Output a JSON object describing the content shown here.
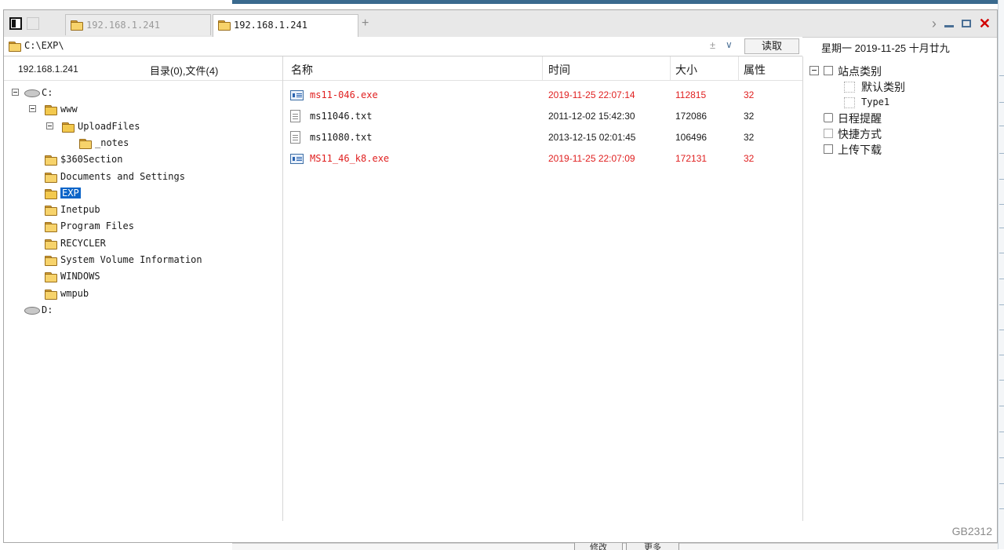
{
  "tabs": [
    {
      "label": "192.168.1.241",
      "active": false
    },
    {
      "label": "192.168.1.241",
      "active": true
    }
  ],
  "tab_add": "+",
  "window_controls": {
    "nav_next": "›",
    "close": "✕"
  },
  "address": {
    "path": "C:\\EXP\\",
    "plus_minus": "±",
    "dropdown": "∨",
    "read_button": "读取"
  },
  "date_label": "星期一  2019-11-25  十月廿九",
  "left": {
    "host": "192.168.1.241",
    "count": "目录(0),文件(4)",
    "tree": [
      {
        "label": "C:",
        "type": "drive",
        "expanded": true
      },
      {
        "label": "www",
        "type": "folder",
        "expanded": true
      },
      {
        "label": "UploadFiles",
        "type": "folder",
        "expanded": true
      },
      {
        "label": "_notes",
        "type": "folder"
      },
      {
        "label": "$360Section",
        "type": "folder"
      },
      {
        "label": "Documents and Settings",
        "type": "folder"
      },
      {
        "label": "EXP",
        "type": "folder",
        "selected": true
      },
      {
        "label": "Inetpub",
        "type": "folder"
      },
      {
        "label": "Program Files",
        "type": "folder"
      },
      {
        "label": "RECYCLER",
        "type": "folder"
      },
      {
        "label": "System Volume Information",
        "type": "folder"
      },
      {
        "label": "WINDOWS",
        "type": "folder"
      },
      {
        "label": "wmpub",
        "type": "folder"
      },
      {
        "label": "D:",
        "type": "drive"
      }
    ]
  },
  "list": {
    "columns": [
      "名称",
      "时间",
      "大小",
      "属性"
    ],
    "rows": [
      {
        "name": "ms11-046.exe",
        "time": "2019-11-25 22:07:14",
        "size": "112815",
        "attr": "32",
        "type": "exe",
        "highlight": true
      },
      {
        "name": "ms11046.txt",
        "time": "2011-12-02 15:42:30",
        "size": "172086",
        "attr": "32",
        "type": "txt",
        "highlight": false
      },
      {
        "name": "ms11080.txt",
        "time": "2013-12-15 02:01:45",
        "size": "106496",
        "attr": "32",
        "type": "txt",
        "highlight": false
      },
      {
        "name": "MS11_46_k8.exe",
        "time": "2019-11-25 22:07:09",
        "size": "172131",
        "attr": "32",
        "type": "exe",
        "highlight": true
      }
    ]
  },
  "right": {
    "root": "站点类别",
    "children": [
      "默认类别",
      "Type1"
    ],
    "items": [
      "日程提醒",
      "快捷方式",
      "上传下载"
    ]
  },
  "encoding": "GB2312",
  "background": {
    "buttons": [
      "修改",
      "更多"
    ]
  },
  "colors": {
    "highlight_text": "#e02020",
    "selection": "#0a64c8",
    "folder": "#f7d36b",
    "accent": "#4a6f95"
  }
}
